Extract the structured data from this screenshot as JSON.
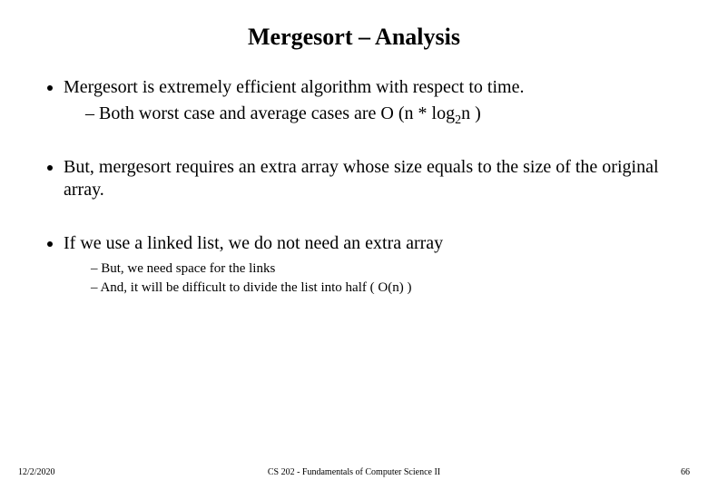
{
  "title": "Mergesort – Analysis",
  "bullets": {
    "b1": {
      "text": "Mergesort is extremely efficient algorithm with respect to time.",
      "sub": {
        "s1_pre": "Both worst case and average cases are O (n * log",
        "s1_sub": "2",
        "s1_post": "n )"
      }
    },
    "b2": {
      "text": "But, mergesort requires an extra array whose size equals to the size of the original array."
    },
    "b3": {
      "text": "If we use a linked list, we do not need an extra array",
      "sub": {
        "s1": "But, we need space for the links",
        "s2": "And, it will be difficult to divide the list into half ( O(n) )"
      }
    }
  },
  "footer": {
    "date": "12/2/2020",
    "course": "CS 202 - Fundamentals of Computer Science II",
    "page": "66"
  }
}
